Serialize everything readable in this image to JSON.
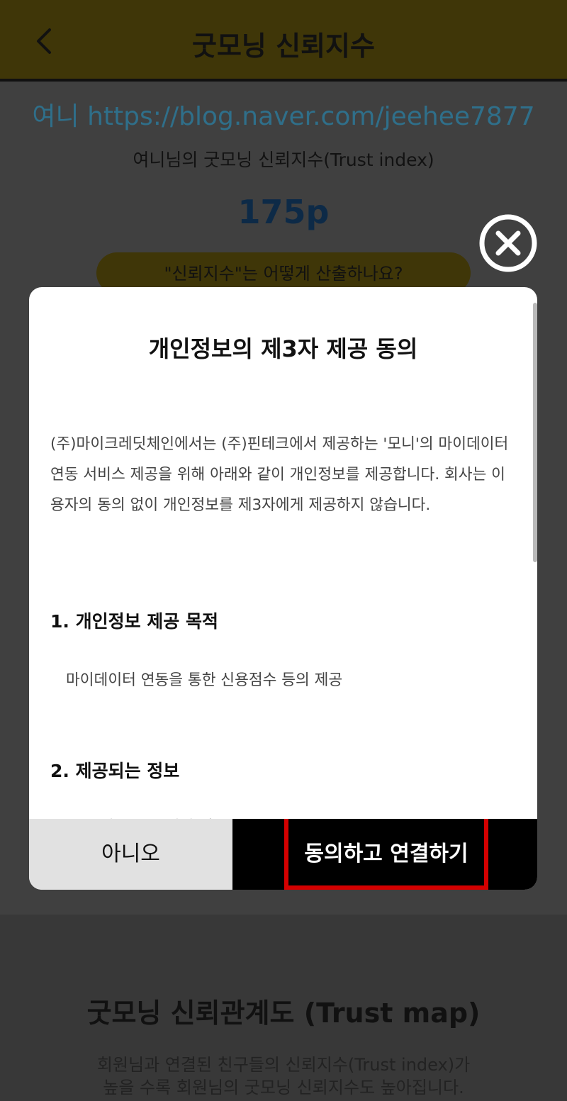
{
  "header": {
    "title": "굿모닝 신뢰지수"
  },
  "profile": {
    "blog_line": "여니 https://blog.naver.com/jeehee7877",
    "trust_index_title": "여니님의 굿모닝 신뢰지수(Trust index)",
    "score": "175p",
    "how_button": "\"신뢰지수\"는 어떻게 산출하나요?"
  },
  "trust_map": {
    "title": "굿모닝 신뢰관계도 (Trust map)",
    "description": "회원님과 연결된 친구들의 신뢰지수(Trust index)가\n높을 수록 회원님의 굿모닝 신뢰지수도 높아집니다."
  },
  "modal": {
    "title": "개인정보의 제3자 제공 동의",
    "intro": "(주)마이크레딧체인에서는 (주)핀테크에서 제공하는 '모니'의 마이데이터 연동 서비스 제공을 위해 아래와 같이 개인정보를 제공합니다. 회사는 이용자의 동의 없이 개인정보를 제3자에게 제공하지 않습니다.",
    "section1_heading": "1. 개인정보 제공 목적",
    "section1_text": "마이데이터 연동을 통한 신용점수 등의 제공",
    "section2_heading": "2. 제공되는 정보",
    "section2_cutoff": "성명, 생년월일, 휴대폰번호",
    "no_button": "아니오",
    "agree_button": "동의하고 연결하기"
  },
  "icons": {
    "back": "chevron-left-icon",
    "close": "close-circle-icon"
  },
  "colors": {
    "header_bg": "#3f3608",
    "highlight": "#d40000",
    "link": "#2f6f8a"
  }
}
